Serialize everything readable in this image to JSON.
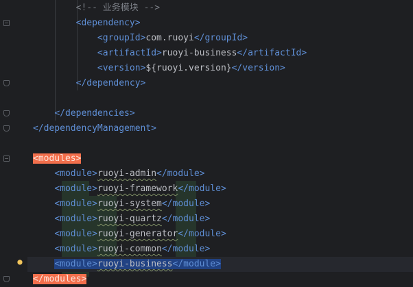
{
  "editor": {
    "lines": [
      {
        "indent": "        ",
        "parts": [
          {
            "cls": "comment",
            "t": "<!-- 业务模块 -->"
          }
        ]
      },
      {
        "indent": "        ",
        "parts": [
          {
            "cls": "tag",
            "t": "<dependency>"
          }
        ]
      },
      {
        "indent": "            ",
        "parts": [
          {
            "cls": "tag",
            "t": "<groupId>"
          },
          {
            "cls": "text",
            "t": "com.ruoyi"
          },
          {
            "cls": "tag",
            "t": "</groupId>"
          }
        ]
      },
      {
        "indent": "            ",
        "parts": [
          {
            "cls": "tag",
            "t": "<artifactId>"
          },
          {
            "cls": "text",
            "t": "ruoyi-business"
          },
          {
            "cls": "tag",
            "t": "</artifactId>"
          }
        ]
      },
      {
        "indent": "            ",
        "parts": [
          {
            "cls": "tag",
            "t": "<version>"
          },
          {
            "cls": "text",
            "t": "${ruoyi.version}"
          },
          {
            "cls": "tag",
            "t": "</version>"
          }
        ]
      },
      {
        "indent": "        ",
        "parts": [
          {
            "cls": "tag",
            "t": "</dependency>"
          }
        ]
      },
      {
        "indent": "",
        "parts": []
      },
      {
        "indent": "    ",
        "parts": [
          {
            "cls": "tag",
            "t": "</dependencies>"
          }
        ]
      },
      {
        "indent": "",
        "parts": [
          {
            "cls": "tag",
            "t": "</dependencyManagement>"
          }
        ]
      },
      {
        "indent": "",
        "parts": []
      },
      {
        "indent": "",
        "parts": [
          {
            "cls": "hl-orange",
            "t": "<modules>"
          }
        ]
      },
      {
        "indent": "    ",
        "parts": [
          {
            "cls": "tag",
            "t": "<module>"
          },
          {
            "cls": "text wavy",
            "t": "ruoyi-admin"
          },
          {
            "cls": "tag",
            "t": "</module>"
          }
        ]
      },
      {
        "indent": "    ",
        "parts": [
          {
            "cls": "tag",
            "t": "<module>"
          },
          {
            "cls": "text wavy",
            "t": "ruoyi-framework"
          },
          {
            "cls": "tag",
            "t": "</module>"
          }
        ]
      },
      {
        "indent": "    ",
        "parts": [
          {
            "cls": "tag",
            "t": "<module>"
          },
          {
            "cls": "text wavy",
            "t": "ruoyi-system"
          },
          {
            "cls": "tag",
            "t": "</module>"
          }
        ]
      },
      {
        "indent": "    ",
        "parts": [
          {
            "cls": "tag",
            "t": "<module>"
          },
          {
            "cls": "text wavy",
            "t": "ruoyi-quartz"
          },
          {
            "cls": "tag",
            "t": "</module>"
          }
        ]
      },
      {
        "indent": "    ",
        "parts": [
          {
            "cls": "tag",
            "t": "<module>"
          },
          {
            "cls": "text wavy",
            "t": "ruoyi-generator"
          },
          {
            "cls": "tag",
            "t": "</module>"
          }
        ]
      },
      {
        "indent": "    ",
        "parts": [
          {
            "cls": "tag",
            "t": "<module>"
          },
          {
            "cls": "text wavy",
            "t": "ruoyi-common"
          },
          {
            "cls": "tag",
            "t": "</module>"
          }
        ]
      },
      {
        "indent": "    ",
        "selected": true,
        "parts": [
          {
            "cls": "tag",
            "t": "<module>"
          },
          {
            "cls": "text wavy",
            "t": "ruoyi-business"
          },
          {
            "cls": "tag",
            "t": "</module>"
          }
        ]
      },
      {
        "indent": "",
        "parts": [
          {
            "cls": "hl-orange",
            "t": "</modules>"
          }
        ]
      }
    ]
  },
  "icons": {
    "intention": "lightbulb-icon",
    "fold": "fold-marker-icon"
  },
  "colors": {
    "background": "#1e1f22",
    "tag": "#5f8fd6",
    "text": "#bcbec4",
    "comment": "#7a7e85",
    "highlight": "#f26f4c",
    "selection": "#214283"
  }
}
